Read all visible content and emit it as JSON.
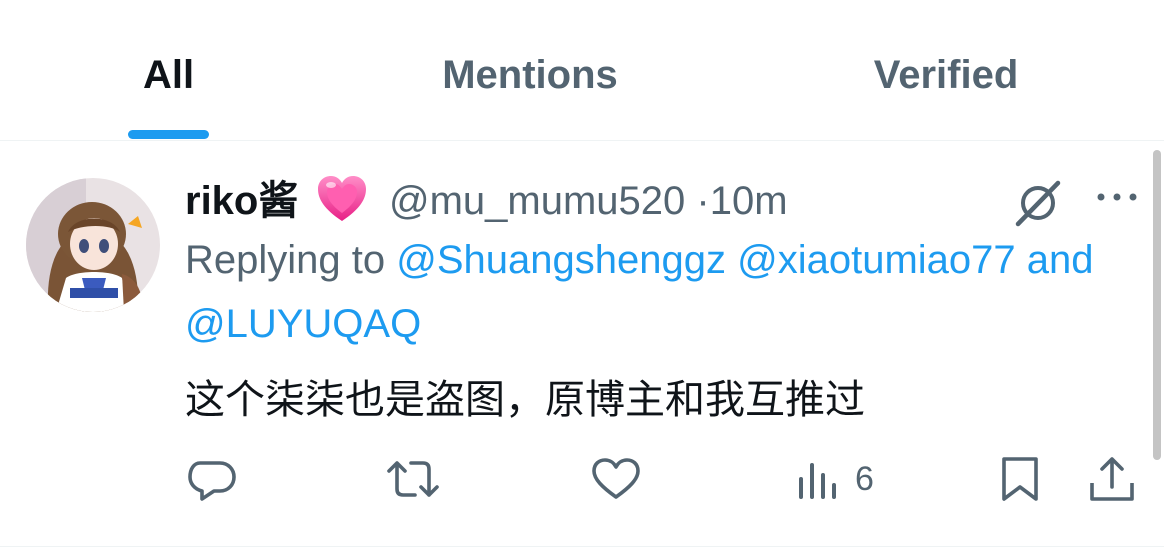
{
  "tabs": [
    {
      "label": "All",
      "active": true
    },
    {
      "label": "Mentions",
      "active": false
    },
    {
      "label": "Verified",
      "active": false
    }
  ],
  "tweet": {
    "display_name": "riko酱",
    "name_emoji": "pink-heart-emoji",
    "handle": "@mu_mumu520",
    "separator": "·",
    "time": "10m",
    "replying_prefix": "Replying to",
    "mentions": [
      "@Shuangshenggz",
      "@xiaotumiao77",
      "@LUYUQAQ"
    ],
    "mention_joiner": "and",
    "text": "这个柒柒也是盗图，原博主和我互推过",
    "views": "6"
  },
  "colors": {
    "accent": "#1d9bf0",
    "text_primary": "#0f1419",
    "text_secondary": "#536471",
    "divider": "#eff3f4"
  }
}
